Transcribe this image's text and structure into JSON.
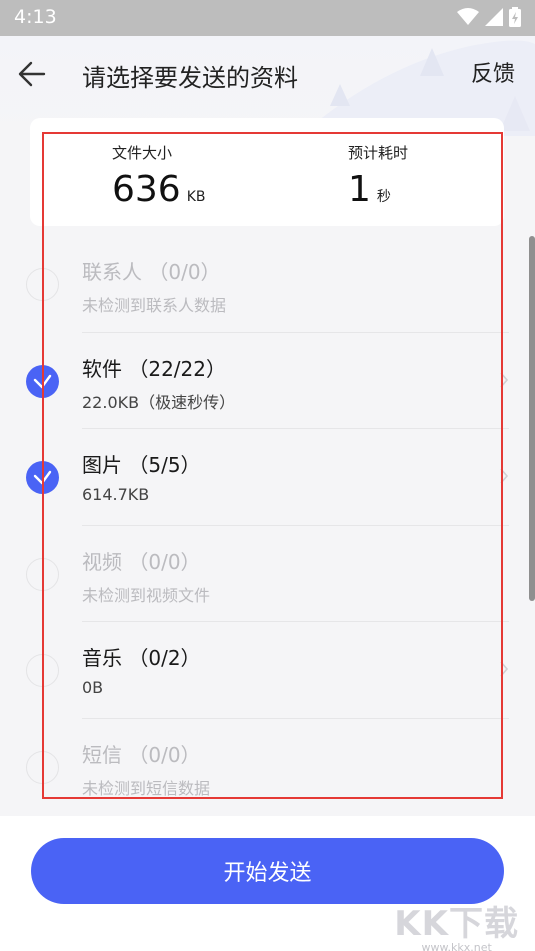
{
  "status_bar": {
    "time": "4:13",
    "icons": [
      "wifi-icon",
      "signal-icon",
      "battery-charging-icon"
    ]
  },
  "header": {
    "title": "请选择要发送的资料",
    "feedback_label": "反馈"
  },
  "summary": {
    "size_label": "文件大小",
    "size_value": "636",
    "size_unit": "KB",
    "time_label": "预计耗时",
    "time_value": "1",
    "time_unit": "秒"
  },
  "items": [
    {
      "title": "联系人 （0/0）",
      "subtitle": "未检测到联系人数据",
      "checked": false,
      "enabled": false
    },
    {
      "title": "软件 （22/22）",
      "subtitle": "22.0KB（极速秒传）",
      "checked": true,
      "enabled": true
    },
    {
      "title": "图片 （5/5）",
      "subtitle": "614.7KB",
      "checked": true,
      "enabled": true
    },
    {
      "title": "视频 （0/0）",
      "subtitle": "未检测到视频文件",
      "checked": false,
      "enabled": false
    },
    {
      "title": "音乐 （0/2）",
      "subtitle": "0B",
      "checked": false,
      "enabled": true
    },
    {
      "title": "短信 （0/0）",
      "subtitle": "未检测到短信数据",
      "checked": false,
      "enabled": false
    }
  ],
  "start_button_label": "开始发送",
  "watermark": {
    "logo": "KK下载",
    "url": "www.kkx.net"
  },
  "colors": {
    "accent": "#4a63f5",
    "highlight": "#e53935"
  }
}
